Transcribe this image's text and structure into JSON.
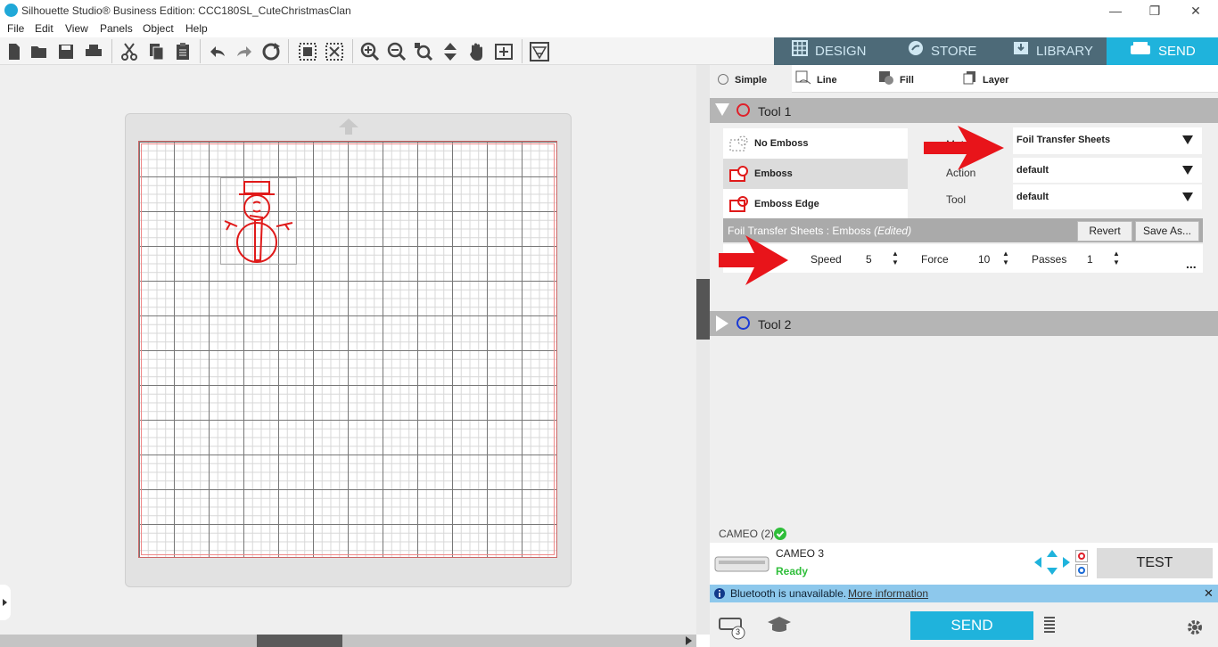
{
  "window": {
    "title": "Silhouette Studio® Business Edition: CCC180SL_CuteChristmasClan",
    "minimize": "—",
    "restore": "❐",
    "close": "✕"
  },
  "menu": [
    "File",
    "Edit",
    "View",
    "Panels",
    "Object",
    "Help"
  ],
  "nav_tabs": [
    {
      "label": "DESIGN",
      "icon": "grid-icon"
    },
    {
      "label": "STORE",
      "icon": "store-icon"
    },
    {
      "label": "LIBRARY",
      "icon": "library-icon"
    },
    {
      "label": "SEND",
      "icon": "send-icon",
      "active": true
    }
  ],
  "mode_tabs": [
    {
      "label": "Simple",
      "active": true
    },
    {
      "label": "Line"
    },
    {
      "label": "Fill"
    },
    {
      "label": "Layer"
    }
  ],
  "tool1": {
    "label": "Tool 1",
    "ring_color": "#e0202a",
    "emboss_options": [
      "No Emboss",
      "Emboss",
      "Emboss Edge"
    ],
    "selected_option": "Emboss",
    "material_label": "Material",
    "material_value": "Foil Transfer Sheets",
    "action_label": "Action",
    "action_value": "default",
    "tool_label": "Tool",
    "tool_value": "default",
    "preset_name": "Foil Transfer Sheets : Emboss",
    "preset_edited": "(Edited)",
    "revert_label": "Revert",
    "save_as_label": "Save As...",
    "speed_label": "Speed",
    "speed_value": "5",
    "force_label": "Force",
    "force_value": "10",
    "passes_label": "Passes",
    "passes_value": "1",
    "more": "..."
  },
  "tool2": {
    "label": "Tool 2",
    "ring_color": "#1a3ad6"
  },
  "device": {
    "header": "CAMEO (2)",
    "name": "CAMEO 3",
    "status": "Ready",
    "status_color": "#2fbe3a",
    "test_label": "TEST"
  },
  "bluetooth": {
    "message": "Bluetooth is unavailable.",
    "link": "More information",
    "close": "✕"
  },
  "bottom": {
    "send_label": "SEND",
    "queue_badge": "3"
  },
  "colors": {
    "accent": "#1fb3dc",
    "nav_bg": "#4d6a78",
    "arrow_red": "#e8141a"
  }
}
